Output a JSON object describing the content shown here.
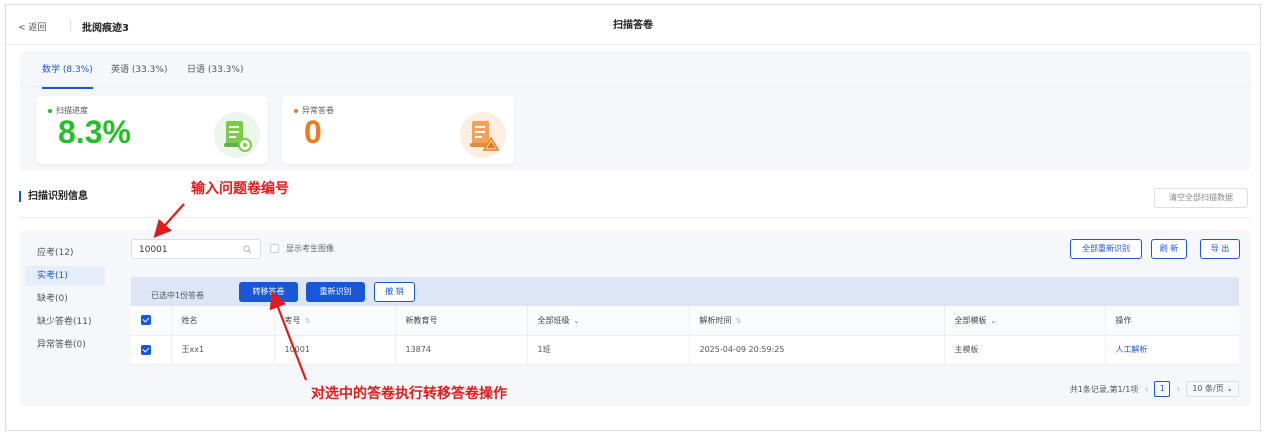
{
  "header": {
    "back_label": "< 返回",
    "doc_title": "批阅痕迹3",
    "page_title": "扫描答卷"
  },
  "subject_tabs": [
    {
      "label": "数学 (8.3%)",
      "active": true
    },
    {
      "label": "英语 (33.3%)",
      "active": false
    },
    {
      "label": "日语 (33.3%)",
      "active": false
    }
  ],
  "cards": {
    "progress": {
      "label": "扫描进度",
      "value": "8.3%",
      "color": "#22c028",
      "icon": "scroll-refresh-icon"
    },
    "abnormal": {
      "label": "异常答卷",
      "value": "0",
      "color": "#f07a18",
      "icon": "scroll-warning-icon"
    }
  },
  "section": {
    "title": "扫描识别信息",
    "clear_all_label": "清空全部扫描数据"
  },
  "sidebar": {
    "items": [
      {
        "label": "应考(12)",
        "active": false
      },
      {
        "label": "实考(1)",
        "active": true
      },
      {
        "label": "缺考(0)",
        "active": false
      },
      {
        "label": "缺少答卷(11)",
        "active": false
      },
      {
        "label": "异常答卷(0)",
        "active": false
      }
    ]
  },
  "toolbar": {
    "search_value": "10001",
    "show_image_label": "显示考生图像",
    "rerecognize_all_label": "全部重新识别",
    "refresh_label": "刷 新",
    "export_label": "导 出"
  },
  "selection": {
    "text": "已选中1份答卷",
    "transfer_label": "转移答卷",
    "rerecognize_label": "重新识别",
    "undo_label": "撤 销"
  },
  "table": {
    "headers": {
      "name": "姓名",
      "exam_no": "考号",
      "new_edu_no": "新教育号",
      "class": "全部班级",
      "parse_time": "解析时间",
      "template": "全部模板",
      "action": "操作"
    },
    "rows": [
      {
        "name": "王xx1",
        "exam_no": "10001",
        "new_edu_no": "13874",
        "class": "1班",
        "parse_time": "2025-04-09 20:59:25",
        "template": "主模板",
        "action": "人工解析"
      }
    ]
  },
  "pagination": {
    "summary": "共1条记录,第1/1项",
    "current_page": "1",
    "page_size": "10 条/页"
  },
  "annotations": {
    "search_hint": "输入问题卷编号",
    "transfer_hint": "对选中的答卷执行转移答卷操作",
    "color": "#e11b1b"
  },
  "colors": {
    "accent": "#1a57d6",
    "progress_green": "#22c028",
    "abnormal_orange": "#f07a18"
  }
}
